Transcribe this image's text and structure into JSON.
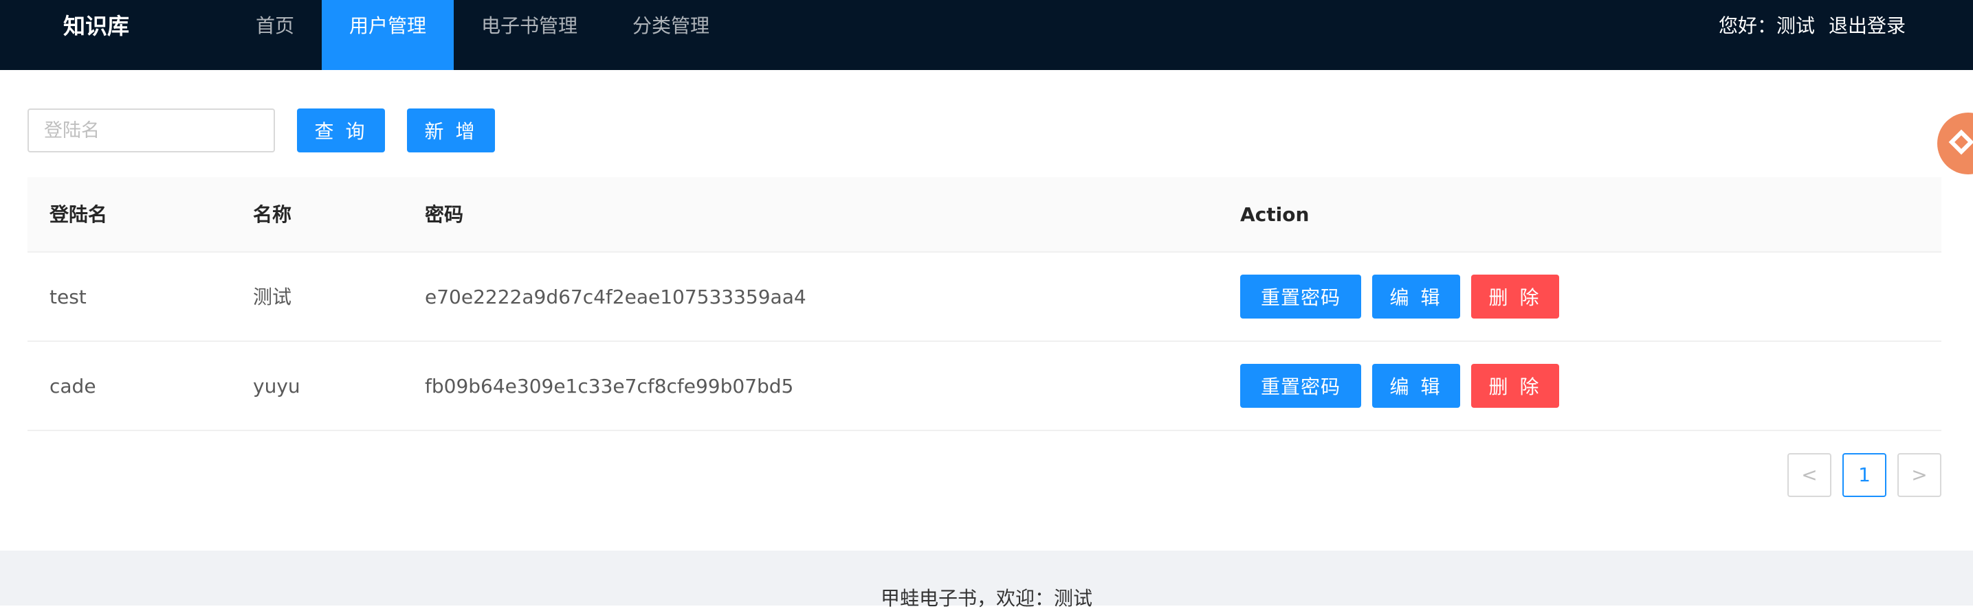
{
  "header": {
    "logo": "知识库",
    "nav": [
      "首页",
      "用户管理",
      "电子书管理",
      "分类管理"
    ],
    "active_nav": "用户管理",
    "greeting": "您好：测试",
    "logout": "退出登录"
  },
  "toolbar": {
    "search_placeholder": "登陆名",
    "query_label": "查 询",
    "add_label": "新 增"
  },
  "table": {
    "columns": [
      "登陆名",
      "名称",
      "密码",
      "Action"
    ],
    "rows": [
      {
        "login": "test",
        "name": "测试",
        "password": "e70e2222a9d67c4f2eae107533359aa4"
      },
      {
        "login": "cade",
        "name": "yuyu",
        "password": "fb09b64e309e1c33e7cf8cfe99b07bd5"
      }
    ],
    "actions": {
      "reset": "重置密码",
      "edit": "编 辑",
      "delete": "删 除"
    }
  },
  "pagination": {
    "prev": "<",
    "current": "1",
    "next": ">"
  },
  "footer": {
    "text": "甲蛙电子书，欢迎：测试"
  },
  "colors": {
    "header_bg": "#041527",
    "primary": "#1890ff",
    "danger": "#ff4d4f",
    "side_widget": "#f08a5d"
  }
}
